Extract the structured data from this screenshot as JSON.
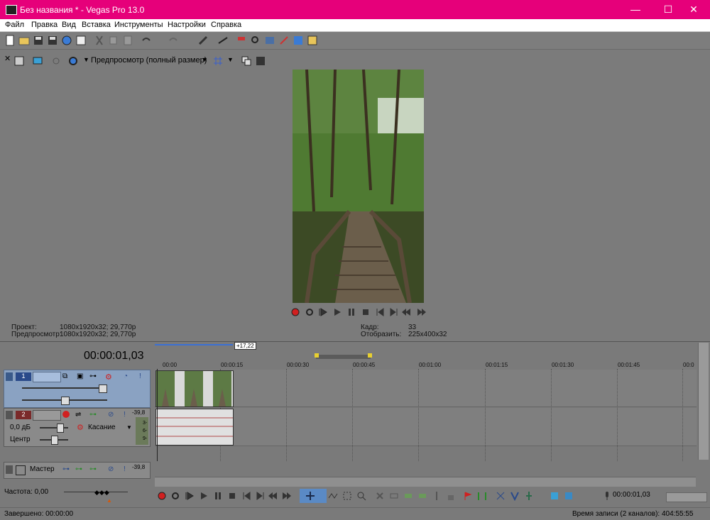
{
  "window": {
    "title": "Без названия * - Vegas Pro 13.0",
    "minimize": "—",
    "maximize": "☐",
    "close": "✕"
  },
  "menu": [
    "Файл",
    "Правка",
    "Вид",
    "Вставка",
    "Инструменты",
    "Настройки",
    "Справка"
  ],
  "preview": {
    "quality_label": "Предпросмотр (полный размер)",
    "project_label": "Проект:",
    "project_value": "1080x1920x32; 29,770p",
    "preview_label": "Предпросмотр:",
    "preview_value": "1080x1920x32; 29,770p",
    "frame_label": "Кадр:",
    "frame_value": "33",
    "display_label": "Отобразить:",
    "display_value": "225x400x32"
  },
  "timeline": {
    "timecode": "00:00:01,03",
    "selection_length": "+17,22",
    "ruler_labels": [
      "00:00",
      "00:00:15",
      "00:00:30",
      "00:00:45",
      "00:01:00",
      "00:01:15",
      "00:01:30",
      "00:01:45",
      "00:0"
    ],
    "track1_number": "1",
    "track2_number": "2",
    "track2_volume": "0,0 дБ",
    "track2_pan": "Центр",
    "track2_mode": "Касание",
    "track2_level": "-39,8",
    "meter_ticks": [
      "3-",
      "6-",
      "9-"
    ],
    "master_label": "Мастер",
    "master_level": "-39,8",
    "rate_label": "Частота: 0,00",
    "cursor_time": "00:00:01,03"
  },
  "status": {
    "left": "Завершено: 00:00:00",
    "right": "Время записи (2 каналов): 404:55:55"
  },
  "colors": {
    "titlebar": "#e6007a",
    "track_video": "#8aa2c2",
    "record": "#d12020"
  }
}
